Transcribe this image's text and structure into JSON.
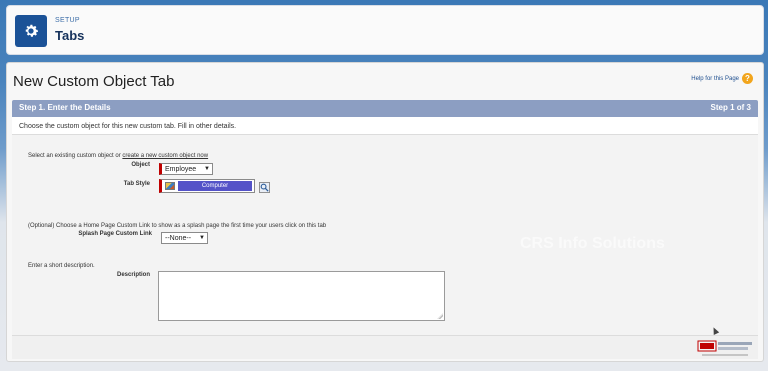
{
  "header": {
    "eyebrow": "SETUP",
    "title": "Tabs",
    "icon": "gear-icon"
  },
  "page": {
    "title": "New Custom Object Tab",
    "help_label": "Help for this Page"
  },
  "step": {
    "title": "Step 1. Enter the Details",
    "count": "Step 1 of 3"
  },
  "instructions": "Choose the custom object for this new custom tab. Fill in other details.",
  "form": {
    "select_intro": "Select an existing custom object or",
    "create_link": "create a new custom object now",
    "object_label": "Object",
    "object_value": "Employee",
    "tab_style_label": "Tab Style",
    "tab_style_value": "Computer",
    "splash_intro": "(Optional) Choose a Home Page Custom Link to show as a splash page the first time your users click on this tab",
    "splash_label": "Splash Page Custom Link",
    "splash_value": "--None--",
    "description_intro": "Enter a short description.",
    "description_label": "Description",
    "description_value": ""
  },
  "watermark": "CRS Info Solutions",
  "colors": {
    "accent_header_icon": "#1b5297",
    "step_bar": "#8c9ec2",
    "required_marker": "#c00000",
    "tab_style_fill": "#5453c8"
  }
}
